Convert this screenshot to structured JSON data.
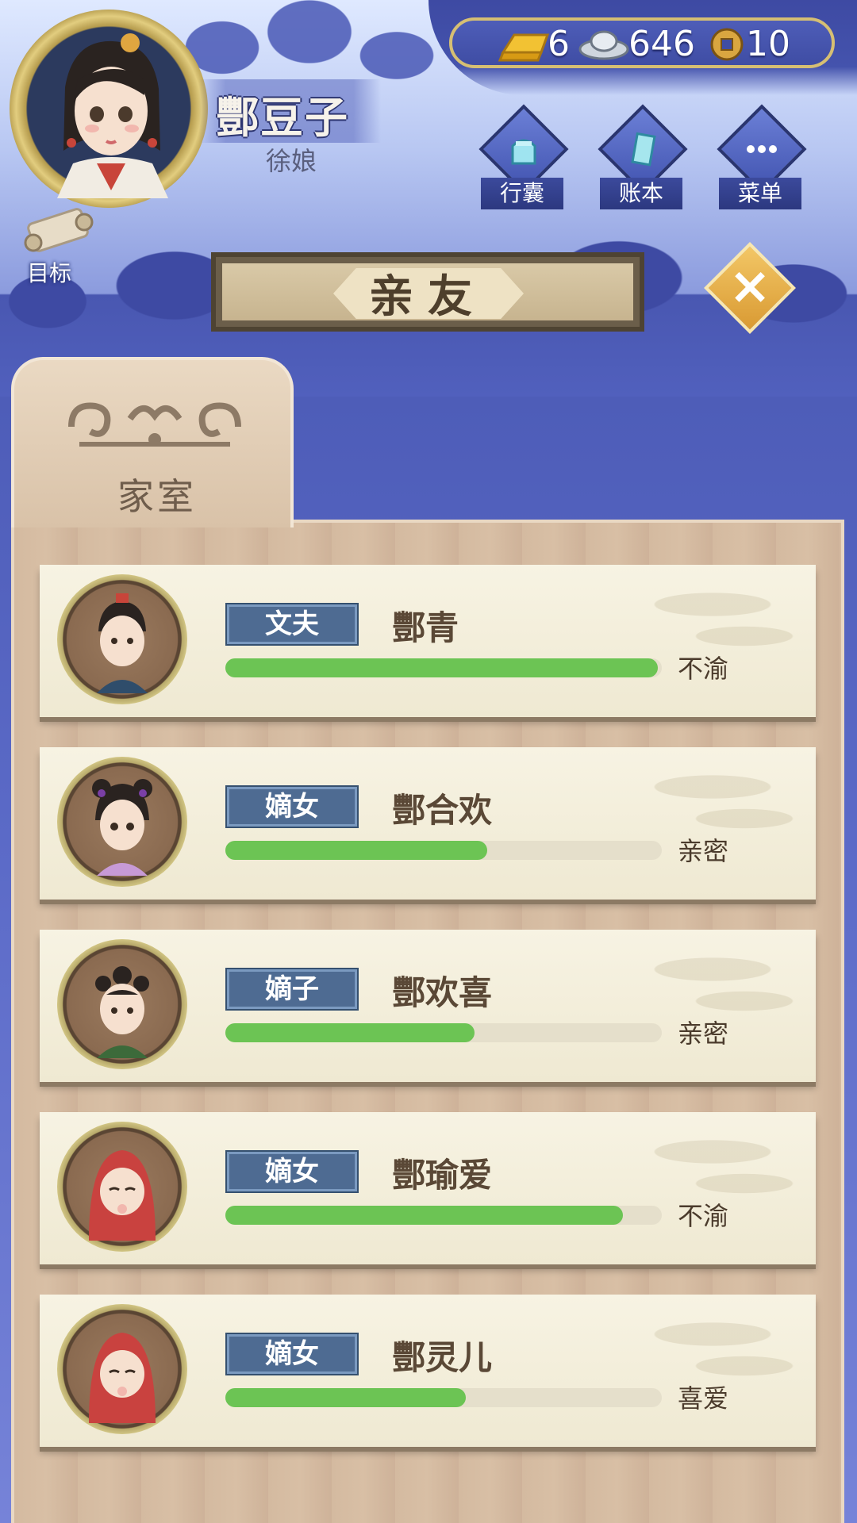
{
  "player": {
    "name": "酆豆子",
    "title": "徐娘"
  },
  "goal": {
    "label": "目标"
  },
  "currency": {
    "gold": "6",
    "silver": "646",
    "coin": "10"
  },
  "menu": {
    "bag": "行囊",
    "ledger": "账本",
    "menu": "菜单"
  },
  "header": {
    "title": "亲友"
  },
  "tab": {
    "label": "家室"
  },
  "relatives": [
    {
      "role": "文夫",
      "name": "酆青",
      "status": "不渝",
      "bond": 0.99
    },
    {
      "role": "嫡女",
      "name": "酆合欢",
      "status": "亲密",
      "bond": 0.6
    },
    {
      "role": "嫡子",
      "name": "酆欢喜",
      "status": "亲密",
      "bond": 0.57
    },
    {
      "role": "嫡女",
      "name": "酆瑜爱",
      "status": "不渝",
      "bond": 0.91
    },
    {
      "role": "嫡女",
      "name": "酆灵儿",
      "status": "喜爱",
      "bond": 0.55
    }
  ],
  "colors": {
    "bar": "#6cc454",
    "role_badge": "#4e6b92",
    "close_button": "#e8b04a"
  },
  "icons": {
    "gold": "gold-ingot-icon",
    "silver": "silver-ingot-icon",
    "coin": "copper-coin-icon",
    "bag": "bag-icon",
    "ledger": "book-icon",
    "menu": "more-icon",
    "close": "close-icon",
    "goal": "scroll-icon"
  }
}
